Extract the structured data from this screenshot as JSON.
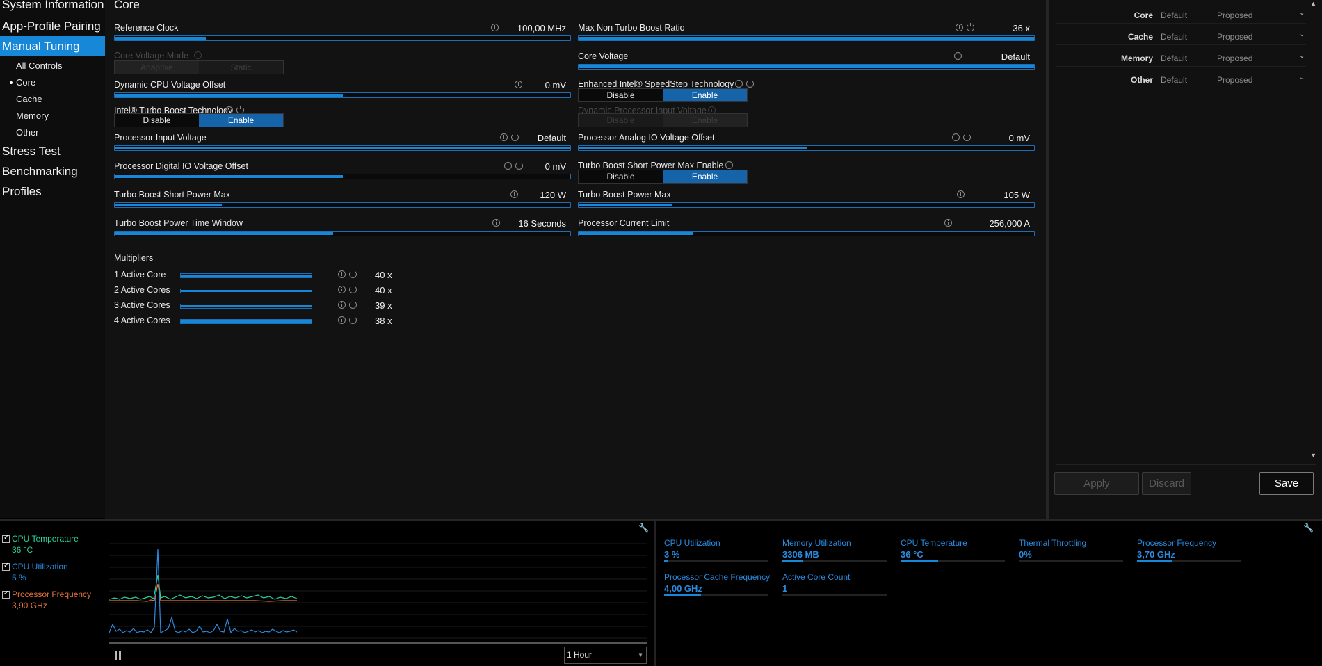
{
  "sidebar": {
    "items": [
      {
        "label": "System Information"
      },
      {
        "label": "App-Profile Pairing"
      },
      {
        "label": "Manual Tuning"
      },
      {
        "label": "Stress Test"
      },
      {
        "label": "Benchmarking"
      },
      {
        "label": "Profiles"
      }
    ],
    "sub_items": [
      {
        "label": "All Controls"
      },
      {
        "label": "Core"
      },
      {
        "label": "Cache"
      },
      {
        "label": "Memory"
      },
      {
        "label": "Other"
      }
    ],
    "active": "Manual Tuning",
    "selected_sub": "Core"
  },
  "main": {
    "title": "Core",
    "settings": {
      "reference_clock": {
        "label": "Reference Clock",
        "value": "100,00 MHz",
        "level": 0.2
      },
      "max_non_turbo": {
        "label": "Max Non Turbo Boost Ratio",
        "value": "36 x",
        "level": 1.0
      },
      "core_voltage_mode": {
        "label": "Core Voltage Mode",
        "options": [
          "Adaptive",
          "Static"
        ],
        "selected": "Adaptive"
      },
      "core_voltage": {
        "label": "Core Voltage",
        "value": "Default",
        "level": 1.0
      },
      "dynamic_cpu_offset": {
        "label": "Dynamic CPU Voltage Offset",
        "value": "0 mV",
        "level": 0.5
      },
      "speedstep": {
        "label": "Enhanced Intel® SpeedStep Technology",
        "options": [
          "Disable",
          "Enable"
        ],
        "selected": "Enable"
      },
      "turbo_boost_tech": {
        "label": "Intel® Turbo Boost Technology",
        "options": [
          "Disable",
          "Enable"
        ],
        "selected": "Enable"
      },
      "dynamic_proc_input": {
        "label": "Dynamic Processor Input Voltage",
        "options": [
          "Disable",
          "Enable"
        ],
        "selected": "Enable"
      },
      "proc_input_voltage": {
        "label": "Processor Input Voltage",
        "value": "Default",
        "level": 1.0
      },
      "proc_analog_io": {
        "label": "Processor Analog IO Voltage Offset",
        "value": "0 mV",
        "level": 0.5
      },
      "proc_digital_io": {
        "label": "Processor Digital IO Voltage Offset",
        "value": "0 mV",
        "level": 0.5
      },
      "turbo_short_enable": {
        "label": "Turbo Boost Short Power Max Enable",
        "options": [
          "Disable",
          "Enable"
        ],
        "selected": "Enable"
      },
      "turbo_short_max": {
        "label": "Turbo Boost Short Power Max",
        "value": "120 W",
        "level": 0.235
      },
      "turbo_power_max": {
        "label": "Turbo Boost Power Max",
        "value": "105 W",
        "level": 0.205
      },
      "turbo_time_window": {
        "label": "Turbo Boost Power Time Window",
        "value": "16 Seconds",
        "level": 0.48
      },
      "proc_current_limit": {
        "label": "Processor Current Limit",
        "value": "256,000 A",
        "level": 0.25
      }
    },
    "multipliers": {
      "title": "Multipliers",
      "rows": [
        {
          "label": "1 Active Core",
          "value": "40 x"
        },
        {
          "label": "2 Active Cores",
          "value": "40 x"
        },
        {
          "label": "3 Active Cores",
          "value": "39 x"
        },
        {
          "label": "4 Active Cores",
          "value": "38 x"
        }
      ]
    }
  },
  "right_panel": {
    "rows": [
      {
        "name": "Core",
        "default": "Default",
        "proposed": "Proposed"
      },
      {
        "name": "Cache",
        "default": "Default",
        "proposed": "Proposed"
      },
      {
        "name": "Memory",
        "default": "Default",
        "proposed": "Proposed"
      },
      {
        "name": "Other",
        "default": "Default",
        "proposed": "Proposed"
      }
    ],
    "buttons": {
      "apply": "Apply",
      "discard": "Discard",
      "save": "Save"
    }
  },
  "monitor": {
    "legend": [
      {
        "name": "CPU Temperature",
        "value": "36 °C",
        "color": "#27d5a0"
      },
      {
        "name": "CPU Utilization",
        "value": "5 %",
        "color": "#2a8be0"
      },
      {
        "name": "Processor Frequency",
        "value": "3,90 GHz",
        "color": "#e8733a"
      }
    ],
    "time_range": "1 Hour",
    "metrics": [
      {
        "name": "CPU Utilization",
        "value": "3 %",
        "level": 0.03
      },
      {
        "name": "Memory Utilization",
        "value": "3306  MB",
        "level": 0.2
      },
      {
        "name": "CPU Temperature",
        "value": "36 °C",
        "level": 0.36
      },
      {
        "name": "Thermal Throttling",
        "value": "0%",
        "level": 0.0
      },
      {
        "name": "Processor Frequency",
        "value": "3,70 GHz",
        "level": 0.33
      },
      {
        "name": "Processor Cache Frequency",
        "value": "4,00 GHz",
        "level": 0.35
      },
      {
        "name": "Active Core Count",
        "value": "1",
        "level": 0.0
      }
    ]
  }
}
